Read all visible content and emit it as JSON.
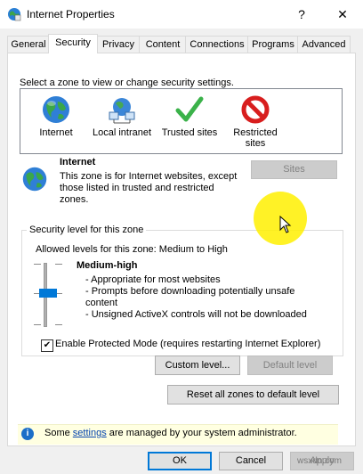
{
  "window": {
    "title": "Internet Properties",
    "help_glyph": "?",
    "close_glyph": "✕"
  },
  "tabs": [
    {
      "label": "General"
    },
    {
      "label": "Security"
    },
    {
      "label": "Privacy"
    },
    {
      "label": "Content"
    },
    {
      "label": "Connections"
    },
    {
      "label": "Programs"
    },
    {
      "label": "Advanced"
    }
  ],
  "active_tab": "Security",
  "zone_prompt": "Select a zone to view or change security settings.",
  "zones": [
    {
      "label": "Internet",
      "icon": "globe-icon"
    },
    {
      "label": "Local intranet",
      "icon": "network-icon"
    },
    {
      "label": "Trusted sites",
      "icon": "checkmark-icon"
    },
    {
      "label": "Restricted sites",
      "icon": "prohibited-icon"
    }
  ],
  "selected_zone": {
    "name": "Internet",
    "description": "This zone is for Internet websites, except those listed in trusted and restricted zones.",
    "sites_button": "Sites"
  },
  "security_level": {
    "group_title": "Security level for this zone",
    "allowed_levels": "Allowed levels for this zone: Medium to High",
    "level_name": "Medium-high",
    "bullets": [
      "- Appropriate for most websites",
      "- Prompts before downloading potentially unsafe content",
      "- Unsigned ActiveX controls will not be downloaded"
    ],
    "protected_mode_label": "Enable Protected Mode (requires restarting Internet Explorer)",
    "protected_mode_checked": true,
    "custom_level_button": "Custom level...",
    "default_level_button": "Default level"
  },
  "reset_all_button": "Reset all zones to default level",
  "admin_notice": {
    "prefix": "Some ",
    "link": "settings",
    "suffix": " are managed by your system administrator."
  },
  "footer": {
    "ok": "OK",
    "cancel": "Cancel",
    "apply": "Apply"
  },
  "watermark": "wsxdn.com",
  "colors": {
    "accent": "#0078d7",
    "info_bar": "#ffffe1",
    "cursor_highlight": "#fff000"
  }
}
